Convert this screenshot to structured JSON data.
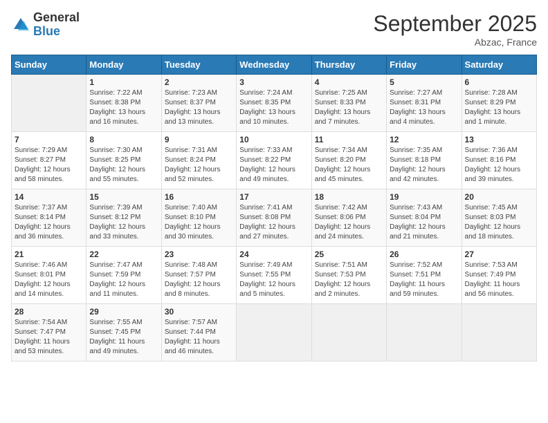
{
  "logo": {
    "text_general": "General",
    "text_blue": "Blue"
  },
  "title": "September 2025",
  "location": "Abzac, France",
  "days_of_week": [
    "Sunday",
    "Monday",
    "Tuesday",
    "Wednesday",
    "Thursday",
    "Friday",
    "Saturday"
  ],
  "weeks": [
    [
      {
        "day": "",
        "info": ""
      },
      {
        "day": "1",
        "info": "Sunrise: 7:22 AM\nSunset: 8:38 PM\nDaylight: 13 hours\nand 16 minutes."
      },
      {
        "day": "2",
        "info": "Sunrise: 7:23 AM\nSunset: 8:37 PM\nDaylight: 13 hours\nand 13 minutes."
      },
      {
        "day": "3",
        "info": "Sunrise: 7:24 AM\nSunset: 8:35 PM\nDaylight: 13 hours\nand 10 minutes."
      },
      {
        "day": "4",
        "info": "Sunrise: 7:25 AM\nSunset: 8:33 PM\nDaylight: 13 hours\nand 7 minutes."
      },
      {
        "day": "5",
        "info": "Sunrise: 7:27 AM\nSunset: 8:31 PM\nDaylight: 13 hours\nand 4 minutes."
      },
      {
        "day": "6",
        "info": "Sunrise: 7:28 AM\nSunset: 8:29 PM\nDaylight: 13 hours\nand 1 minute."
      }
    ],
    [
      {
        "day": "7",
        "info": "Sunrise: 7:29 AM\nSunset: 8:27 PM\nDaylight: 12 hours\nand 58 minutes."
      },
      {
        "day": "8",
        "info": "Sunrise: 7:30 AM\nSunset: 8:25 PM\nDaylight: 12 hours\nand 55 minutes."
      },
      {
        "day": "9",
        "info": "Sunrise: 7:31 AM\nSunset: 8:24 PM\nDaylight: 12 hours\nand 52 minutes."
      },
      {
        "day": "10",
        "info": "Sunrise: 7:33 AM\nSunset: 8:22 PM\nDaylight: 12 hours\nand 49 minutes."
      },
      {
        "day": "11",
        "info": "Sunrise: 7:34 AM\nSunset: 8:20 PM\nDaylight: 12 hours\nand 45 minutes."
      },
      {
        "day": "12",
        "info": "Sunrise: 7:35 AM\nSunset: 8:18 PM\nDaylight: 12 hours\nand 42 minutes."
      },
      {
        "day": "13",
        "info": "Sunrise: 7:36 AM\nSunset: 8:16 PM\nDaylight: 12 hours\nand 39 minutes."
      }
    ],
    [
      {
        "day": "14",
        "info": "Sunrise: 7:37 AM\nSunset: 8:14 PM\nDaylight: 12 hours\nand 36 minutes."
      },
      {
        "day": "15",
        "info": "Sunrise: 7:39 AM\nSunset: 8:12 PM\nDaylight: 12 hours\nand 33 minutes."
      },
      {
        "day": "16",
        "info": "Sunrise: 7:40 AM\nSunset: 8:10 PM\nDaylight: 12 hours\nand 30 minutes."
      },
      {
        "day": "17",
        "info": "Sunrise: 7:41 AM\nSunset: 8:08 PM\nDaylight: 12 hours\nand 27 minutes."
      },
      {
        "day": "18",
        "info": "Sunrise: 7:42 AM\nSunset: 8:06 PM\nDaylight: 12 hours\nand 24 minutes."
      },
      {
        "day": "19",
        "info": "Sunrise: 7:43 AM\nSunset: 8:04 PM\nDaylight: 12 hours\nand 21 minutes."
      },
      {
        "day": "20",
        "info": "Sunrise: 7:45 AM\nSunset: 8:03 PM\nDaylight: 12 hours\nand 18 minutes."
      }
    ],
    [
      {
        "day": "21",
        "info": "Sunrise: 7:46 AM\nSunset: 8:01 PM\nDaylight: 12 hours\nand 14 minutes."
      },
      {
        "day": "22",
        "info": "Sunrise: 7:47 AM\nSunset: 7:59 PM\nDaylight: 12 hours\nand 11 minutes."
      },
      {
        "day": "23",
        "info": "Sunrise: 7:48 AM\nSunset: 7:57 PM\nDaylight: 12 hours\nand 8 minutes."
      },
      {
        "day": "24",
        "info": "Sunrise: 7:49 AM\nSunset: 7:55 PM\nDaylight: 12 hours\nand 5 minutes."
      },
      {
        "day": "25",
        "info": "Sunrise: 7:51 AM\nSunset: 7:53 PM\nDaylight: 12 hours\nand 2 minutes."
      },
      {
        "day": "26",
        "info": "Sunrise: 7:52 AM\nSunset: 7:51 PM\nDaylight: 11 hours\nand 59 minutes."
      },
      {
        "day": "27",
        "info": "Sunrise: 7:53 AM\nSunset: 7:49 PM\nDaylight: 11 hours\nand 56 minutes."
      }
    ],
    [
      {
        "day": "28",
        "info": "Sunrise: 7:54 AM\nSunset: 7:47 PM\nDaylight: 11 hours\nand 53 minutes."
      },
      {
        "day": "29",
        "info": "Sunrise: 7:55 AM\nSunset: 7:45 PM\nDaylight: 11 hours\nand 49 minutes."
      },
      {
        "day": "30",
        "info": "Sunrise: 7:57 AM\nSunset: 7:44 PM\nDaylight: 11 hours\nand 46 minutes."
      },
      {
        "day": "",
        "info": ""
      },
      {
        "day": "",
        "info": ""
      },
      {
        "day": "",
        "info": ""
      },
      {
        "day": "",
        "info": ""
      }
    ]
  ]
}
